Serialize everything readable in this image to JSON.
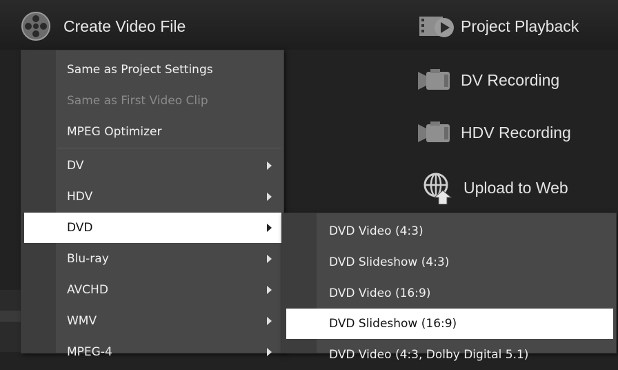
{
  "toolbar": {
    "create_video_file": "Create Video File",
    "project_playback": "Project Playback",
    "dv_recording": "DV Recording",
    "hdv_recording": "HDV Recording",
    "upload_to_web": "Upload to Web"
  },
  "menu": {
    "items": [
      {
        "label": "Same as Project Settings"
      },
      {
        "label": "Same as First Video Clip"
      },
      {
        "label": "MPEG Optimizer"
      },
      {
        "label": "DV"
      },
      {
        "label": "HDV"
      },
      {
        "label": "DVD"
      },
      {
        "label": "Blu-ray"
      },
      {
        "label": "AVCHD"
      },
      {
        "label": "WMV"
      },
      {
        "label": "MPEG-4"
      }
    ]
  },
  "submenu": {
    "items": [
      {
        "label": "DVD Video (4:3)"
      },
      {
        "label": "DVD Slideshow (4:3)"
      },
      {
        "label": "DVD Video (16:9)"
      },
      {
        "label": "DVD Slideshow (16:9)"
      },
      {
        "label": "DVD Video (4:3, Dolby Digital 5.1)"
      }
    ]
  },
  "colors": {
    "background": "#222222",
    "menu_bg": "#484848",
    "menu_gutter": "#3d3d3d",
    "highlight": "#ffffff",
    "disabled_text": "#8a8a8a"
  }
}
